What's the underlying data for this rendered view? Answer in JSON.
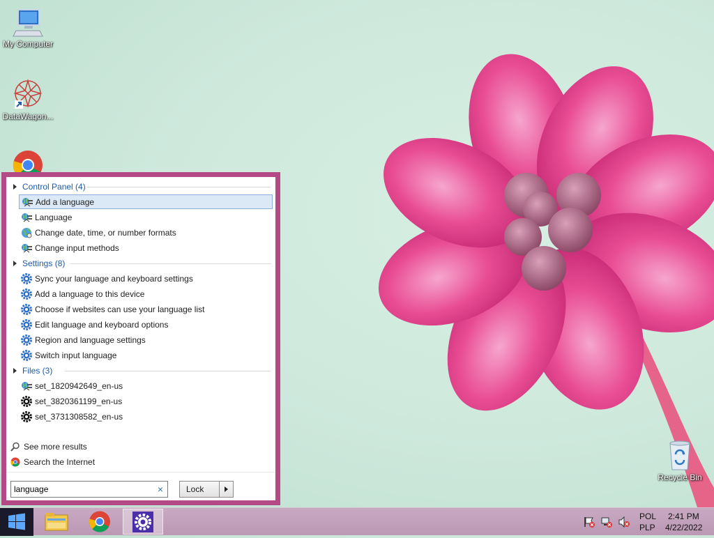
{
  "desktop": {
    "icons": [
      {
        "label": "My Computer"
      },
      {
        "label": "DataWagon..."
      },
      {
        "label": ""
      },
      {
        "label": "Recycle Bin"
      }
    ]
  },
  "search_panel": {
    "groups": [
      {
        "title": "Control Panel (4)",
        "items": [
          {
            "label": "Add a language",
            "icon": "language-icon",
            "selected": true
          },
          {
            "label": "Language",
            "icon": "language-icon"
          },
          {
            "label": "Change date, time, or number formats",
            "icon": "region-globe-icon"
          },
          {
            "label": "Change input methods",
            "icon": "language-icon"
          }
        ]
      },
      {
        "title": "Settings (8)",
        "items": [
          {
            "label": "Sync your language and keyboard settings",
            "icon": "gear-icon"
          },
          {
            "label": "Add a language to this device",
            "icon": "gear-icon"
          },
          {
            "label": "Choose if websites can use your language list",
            "icon": "gear-icon"
          },
          {
            "label": "Edit language and keyboard options",
            "icon": "gear-icon"
          },
          {
            "label": "Region and language settings",
            "icon": "gear-icon"
          },
          {
            "label": "Switch input language",
            "icon": "gear-icon"
          }
        ]
      },
      {
        "title": "Files (3)",
        "items": [
          {
            "label": "set_1820942649_en-us",
            "icon": "language-icon"
          },
          {
            "label": "set_3820361199_en-us",
            "icon": "file-gear-icon"
          },
          {
            "label": "set_3731308582_en-us",
            "icon": "file-gear-icon"
          }
        ]
      }
    ],
    "see_more": "See more results",
    "search_internet": "Search the Internet",
    "search_value": "language",
    "clear_glyph": "×",
    "lock_label": "Lock"
  },
  "tray": {
    "lang_top": "POL",
    "lang_bottom": "PLP",
    "time": "2:41 PM",
    "date": "4/22/2022"
  },
  "colors": {
    "panel_border": "#b34a86",
    "link_blue": "#1e5aa8",
    "selection": "#dbe8f5"
  }
}
